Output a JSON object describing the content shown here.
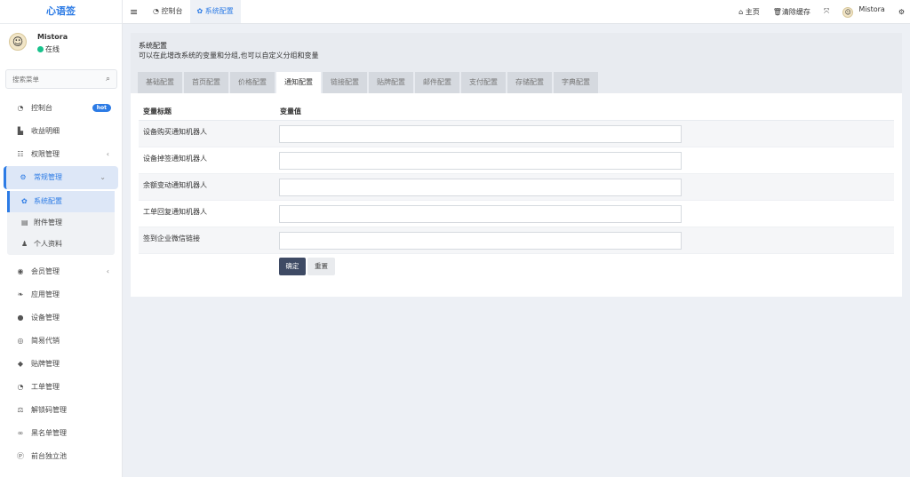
{
  "brand": "心语签",
  "user": {
    "name": "Mistora",
    "status": "在线"
  },
  "search": {
    "placeholder": "搜索菜单"
  },
  "menu": [
    {
      "label": "控制台",
      "icon": "dashboard-icon",
      "glyph": "◔",
      "badge": "hot"
    },
    {
      "label": "收益明细",
      "icon": "bar-chart-icon",
      "glyph": "▙"
    },
    {
      "label": "权限管理",
      "icon": "users-icon",
      "glyph": "☷",
      "arrow": "‹"
    },
    {
      "label": "常规管理",
      "icon": "cogs-icon",
      "glyph": "⚙",
      "arrow": "⌄",
      "active": true
    },
    {
      "label": "会员管理",
      "icon": "user-circle-icon",
      "glyph": "◉",
      "arrow": "‹"
    },
    {
      "label": "应用管理",
      "icon": "leaf-icon",
      "glyph": "❧"
    },
    {
      "label": "设备管理",
      "icon": "circle-icon",
      "glyph": "●"
    },
    {
      "label": "简易代销",
      "icon": "shop-icon",
      "glyph": "◎"
    },
    {
      "label": "贴牌管理",
      "icon": "tags-icon",
      "glyph": "◆"
    },
    {
      "label": "工单管理",
      "icon": "ticket-icon",
      "glyph": "◔"
    },
    {
      "label": "解锁码管理",
      "icon": "balance-icon",
      "glyph": "⚖"
    },
    {
      "label": "黑名单管理",
      "icon": "glasses-icon",
      "glyph": "∞"
    },
    {
      "label": "前台独立池",
      "icon": "parking-icon",
      "glyph": "Ⓟ"
    }
  ],
  "submenu": [
    {
      "label": "系统配置",
      "icon": "gear-icon",
      "glyph": "✿",
      "active": true
    },
    {
      "label": "附件管理",
      "icon": "file-image-icon",
      "glyph": "▤"
    },
    {
      "label": "个人资料",
      "icon": "user-icon",
      "glyph": "♟"
    }
  ],
  "topbar": {
    "tabs": [
      {
        "label": "控制台",
        "icon": "dashboard-icon",
        "glyph": "◔"
      },
      {
        "label": "系统配置",
        "icon": "gear-icon",
        "glyph": "✿",
        "active": true
      }
    ],
    "right": {
      "home": "主页",
      "clear_cache": "清除缓存",
      "username": "Mistora"
    }
  },
  "page": {
    "title": "系统配置",
    "subtitle": "可以在此增改系统的变量和分组,也可以自定义分组和变量",
    "tabs": [
      "基础配置",
      "首页配置",
      "价格配置",
      "通知配置",
      "链接配置",
      "贴牌配置",
      "邮件配置",
      "支付配置",
      "存储配置",
      "字典配置"
    ],
    "active_tab": "通知配置"
  },
  "table": {
    "headers": [
      "变量标题",
      "变量值"
    ],
    "rows": [
      {
        "title": "设备购买通知机器人",
        "value": ""
      },
      {
        "title": "设备掉签通知机器人",
        "value": ""
      },
      {
        "title": "余额变动通知机器人",
        "value": ""
      },
      {
        "title": "工单回复通知机器人",
        "value": ""
      },
      {
        "title": "签到企业微信链接",
        "value": ""
      }
    ]
  },
  "buttons": {
    "submit": "确定",
    "reset": "重置"
  },
  "colors": {
    "primary": "#2c7be5",
    "dark_button": "#3e4a64",
    "online": "#18c28c",
    "background": "#edf0f5"
  }
}
